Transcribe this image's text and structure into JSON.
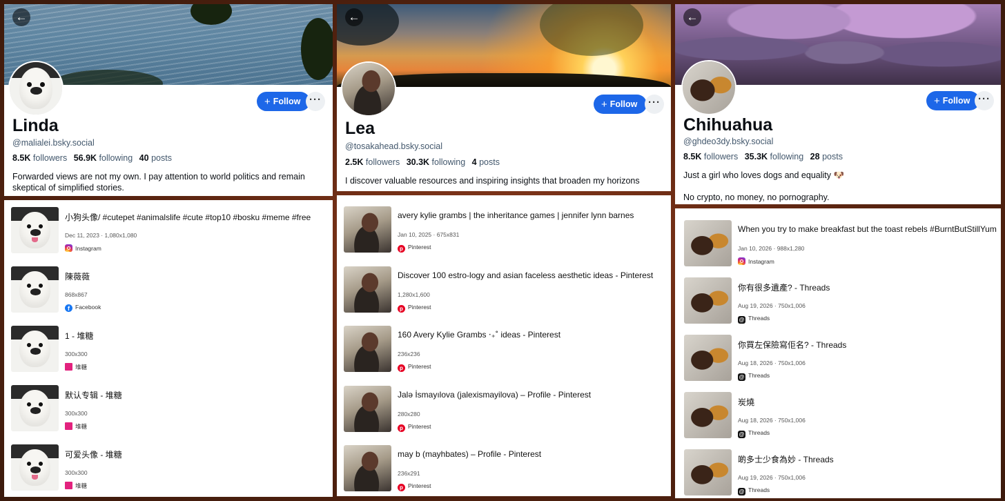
{
  "profiles": [
    {
      "name": "Linda",
      "handle": "@malialei.bsky.social",
      "followers_count": "8.5K",
      "followers_label": "followers",
      "following_count": "56.9K",
      "following_label": "following",
      "posts_count": "40",
      "posts_label": "posts",
      "bio_line1": "Forwarded views are not my own. I pay attention to world politics and remain",
      "bio_line2": "skeptical of simplified stories.",
      "follow_label": "Follow",
      "results": [
        {
          "title": "小狗头像/ #cutepet #animalslife #cute #top10 #bosku #meme #free",
          "meta": "Dec 11, 2023 · 1,080x1,080",
          "source": "Instagram",
          "source_icon": "instagram-icon"
        },
        {
          "title": "陳薇薇",
          "meta": "868x867",
          "source": "Facebook",
          "source_icon": "facebook-icon"
        },
        {
          "title": "1 - 堆糖",
          "meta": "300x300",
          "source": "堆糖",
          "source_icon": "tangtang-icon"
        },
        {
          "title": "默认专辑 - 堆糖",
          "meta": "300x300",
          "source": "堆糖",
          "source_icon": "tangtang-icon"
        },
        {
          "title": "可爱头像 - 堆糖",
          "meta": "300x300",
          "source": "堆糖",
          "source_icon": "tangtang-icon"
        }
      ]
    },
    {
      "name": "Lea",
      "handle": "@tosakahead.bsky.social",
      "followers_count": "2.5K",
      "followers_label": "followers",
      "following_count": "30.3K",
      "following_label": "following",
      "posts_count": "4",
      "posts_label": "posts",
      "bio_line1": "I discover valuable resources and inspiring insights that broaden my horizons",
      "bio_line2": "",
      "follow_label": "Follow",
      "results": [
        {
          "title": "avery kylie grambs | the inheritance games | jennifer lynn barnes",
          "meta": "Jan 10, 2025 · 675x831",
          "source": "Pinterest",
          "source_icon": "pinterest-icon"
        },
        {
          "title": "Discover 100 estro-logy and asian faceless aesthetic ideas - Pinterest",
          "meta": "1,280x1,600",
          "source": "Pinterest",
          "source_icon": "pinterest-icon"
        },
        {
          "title": "160 Avery Kylie Grambs ‧₊˚ ideas - Pinterest",
          "meta": "236x236",
          "source": "Pinterest",
          "source_icon": "pinterest-icon"
        },
        {
          "title": "Jalə İsmayılova (jalexismayilova) – Profile - Pinterest",
          "meta": "280x280",
          "source": "Pinterest",
          "source_icon": "pinterest-icon"
        },
        {
          "title": "may b (mayhbates) – Profile - Pinterest",
          "meta": "236x291",
          "source": "Pinterest",
          "source_icon": "pinterest-icon"
        }
      ]
    },
    {
      "name": "Chihuahua",
      "handle": "@ghdeo3dy.bsky.social",
      "followers_count": "8.5K",
      "followers_label": "followers",
      "following_count": "35.3K",
      "following_label": "following",
      "posts_count": "28",
      "posts_label": "posts",
      "bio_line1": "Just a girl who loves dogs and equality 🐶",
      "bio_line2": "No crypto, no money, no pornography.",
      "follow_label": "Follow",
      "results": [
        {
          "title": "When you try to make breakfast but the toast rebels #BurntButStillYum",
          "meta": "Jan 10, 2026 · 988x1,280",
          "source": "Instagram",
          "source_icon": "instagram-icon"
        },
        {
          "title": "你有很多遺產?  - Threads",
          "meta": "Aug 19, 2026 · 750x1,006",
          "source": "Threads",
          "source_icon": "threads-icon"
        },
        {
          "title": "你買左保險寫佢名?  - Threads",
          "meta": "Aug 18, 2026 · 750x1,006",
          "source": "Threads",
          "source_icon": "threads-icon"
        },
        {
          "title": "炭燒",
          "meta": "Aug 18, 2026 · 750x1,006",
          "source": "Threads",
          "source_icon": "threads-icon"
        },
        {
          "title": "啲多士少食為妙 - Threads",
          "meta": "Aug 19, 2026 · 750x1,006",
          "source": "Threads",
          "source_icon": "threads-icon"
        }
      ]
    }
  ],
  "colors": {
    "follow_button": "#1d67e8",
    "handle_text": "#42576c",
    "background": "#5a2410"
  }
}
